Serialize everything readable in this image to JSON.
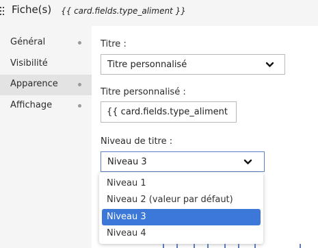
{
  "header": {
    "title": "Fiche(s)",
    "subtitle": "{{ card.fields.type_aliment }}"
  },
  "sidebar": {
    "items": [
      {
        "label": "Général",
        "dot": true,
        "active": false
      },
      {
        "label": "Visibilité",
        "dot": false,
        "active": false
      },
      {
        "label": "Apparence",
        "dot": true,
        "active": true
      },
      {
        "label": "Affichage",
        "dot": true,
        "active": false
      }
    ]
  },
  "form": {
    "title_label": "Titre :",
    "title_select_value": "Titre personnalisé",
    "custom_title_label": "Titre personnalisé :",
    "custom_title_value": "{{ card.fields.type_aliment }}",
    "level_label": "Niveau de titre :",
    "level_select_value": "Niveau 3"
  },
  "level_options": [
    {
      "label": "Niveau 1",
      "selected": false
    },
    {
      "label": "Niveau 2 (valeur par défaut)",
      "selected": false
    },
    {
      "label": "Niveau 3",
      "selected": true
    },
    {
      "label": "Niveau 4",
      "selected": false
    }
  ],
  "colors": {
    "accent": "#3b78d8",
    "focus_border": "#5a7fc4",
    "sidebar_bg": "#f5f5f5",
    "sidebar_active": "#e3e3e3"
  },
  "icons": {
    "drag": "drag-handle-icon",
    "chevron": "chevron-down-icon",
    "dot": "status-dot-icon"
  }
}
